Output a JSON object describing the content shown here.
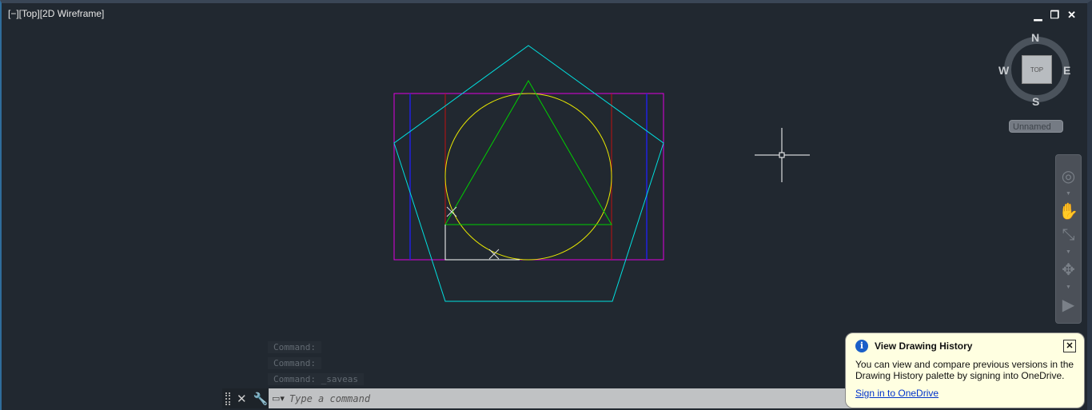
{
  "viewport": {
    "label": "[−][Top][2D Wireframe]",
    "controls": [
      "▁",
      "❐",
      "✕"
    ]
  },
  "viewcube": {
    "north": "N",
    "south": "S",
    "east": "E",
    "west": "W",
    "face": "TOP",
    "ucs": "Unnamed"
  },
  "colors": {
    "rect": "#e000e0",
    "pentagon": "#00e0e0",
    "circle": "#e8e800",
    "triangle": "#00d000",
    "blue": "#2020e0",
    "red": "#c01010"
  },
  "command": {
    "history": [
      "Command:",
      "Command:",
      "Command: _saveas"
    ],
    "placeholder": "Type a command"
  },
  "notification": {
    "title": "View Drawing History",
    "body": "You can view and compare previous versions in the Drawing History palette by signing into OneDrive.",
    "link": "Sign in to OneDrive"
  }
}
